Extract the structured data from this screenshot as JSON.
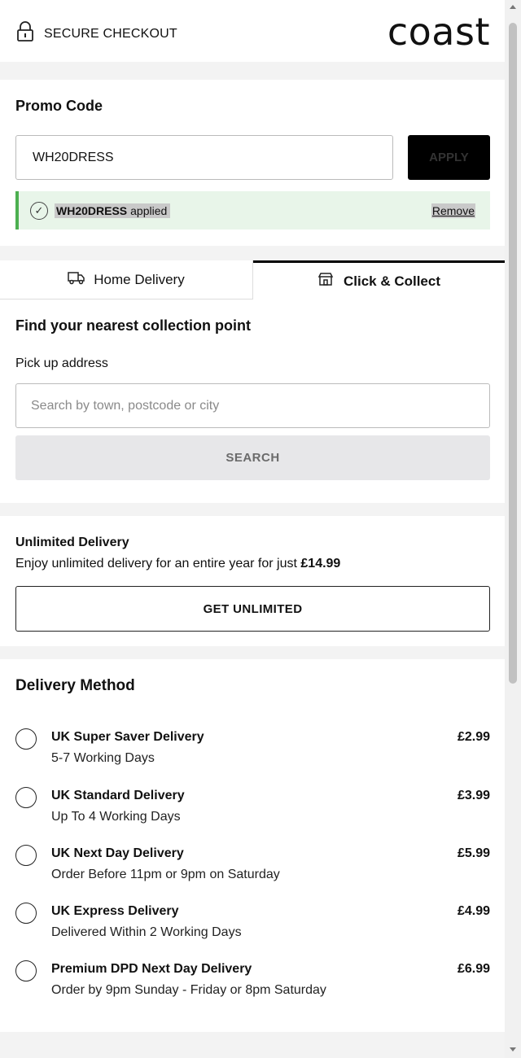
{
  "header": {
    "secure_label": "SECURE CHECKOUT",
    "logo": "coast",
    "lock_icon": "lock-icon"
  },
  "promo": {
    "title": "Promo Code",
    "input_value": "WH20DRESS",
    "apply_label": "APPLY",
    "applied_code": "WH20DRESS",
    "applied_text": "applied",
    "remove_label": "Remove",
    "check_icon": "check-circle-icon"
  },
  "tabs": {
    "home_label": "Home Delivery",
    "home_icon": "truck-icon",
    "collect_label": "Click & Collect",
    "collect_icon": "store-icon"
  },
  "collect": {
    "title": "Find your nearest collection point",
    "address_label": "Pick up address",
    "search_placeholder": "Search by town, postcode or city",
    "search_label": "SEARCH"
  },
  "unlimited": {
    "title": "Unlimited Delivery",
    "desc": "Enjoy unlimited delivery for an entire year for just ",
    "price": "£14.99",
    "button_label": "GET UNLIMITED"
  },
  "delivery": {
    "title": "Delivery Method",
    "options": [
      {
        "name": "UK Super Saver Delivery",
        "sub": "5-7 Working Days",
        "price": "£2.99"
      },
      {
        "name": "UK Standard Delivery",
        "sub": "Up To 4 Working Days",
        "price": "£3.99"
      },
      {
        "name": "UK Next Day Delivery",
        "sub": "Order Before 11pm or 9pm on Saturday",
        "price": "£5.99"
      },
      {
        "name": "UK Express Delivery",
        "sub": "Delivered Within 2 Working Days",
        "price": "£4.99"
      },
      {
        "name": "Premium DPD Next Day Delivery",
        "sub": "Order by 9pm Sunday - Friday or 8pm Saturday",
        "price": "£6.99"
      }
    ]
  },
  "colors": {
    "applied_bg": "#e8f5e9",
    "applied_accent": "#4caf50",
    "primary": "#000000",
    "search_btn_bg": "#e7e7e9",
    "section_gap": "#f3f3f3"
  }
}
